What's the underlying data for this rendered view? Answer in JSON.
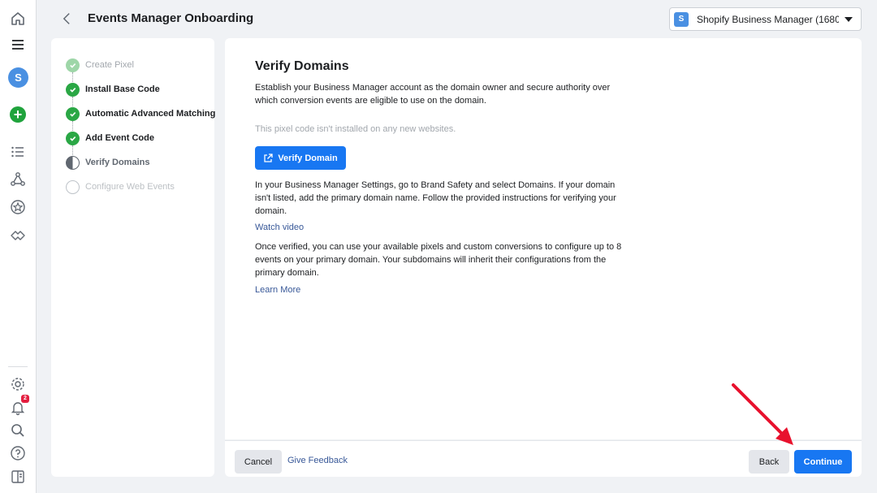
{
  "rail": {
    "avatar_letter": "S",
    "plus_symbol": "+",
    "notification_count": "2",
    "icons": [
      "home-icon",
      "menu-icon",
      "list-icon",
      "graph-icon",
      "star-icon",
      "partner-icon",
      "settings-icon",
      "bell-icon",
      "search-icon",
      "help-icon",
      "panel-icon"
    ]
  },
  "header": {
    "title": "Events Manager Onboarding",
    "business_logo_letter": "S",
    "business_select": "Shopify Business Manager (1680..."
  },
  "steps": [
    {
      "label": "Create Pixel",
      "state": "done-muted"
    },
    {
      "label": "Install Base Code",
      "state": "done"
    },
    {
      "label": "Automatic Advanced Matching",
      "state": "done"
    },
    {
      "label": "Add Event Code",
      "state": "done"
    },
    {
      "label": "Verify Domains",
      "state": "current"
    },
    {
      "label": "Configure Web Events",
      "state": "future"
    }
  ],
  "main": {
    "heading": "Verify Domains",
    "intro": "Establish your Business Manager account as the domain owner and secure authority over which conversion events are eligible to use on the domain.",
    "status": "This pixel code isn't installed on any new websites.",
    "verify_button": "Verify Domain",
    "instructions": "In your Business Manager Settings, go to Brand Safety and select Domains. If your domain isn't listed, add the primary domain name. Follow the provided instructions for verifying your domain.",
    "watch_video": "Watch video",
    "once_verified": "Once verified, you can use your available pixels and custom conversions to configure up to 8 events on your primary domain. Your subdomains will inherit their configurations from the primary domain.",
    "learn_more": "Learn More"
  },
  "footer": {
    "cancel": "Cancel",
    "feedback": "Give Feedback",
    "back": "Back",
    "continue": "Continue"
  },
  "colors": {
    "primary": "#1877f2",
    "success": "#2aa745",
    "link": "#385898",
    "arrow": "#e8112d"
  }
}
